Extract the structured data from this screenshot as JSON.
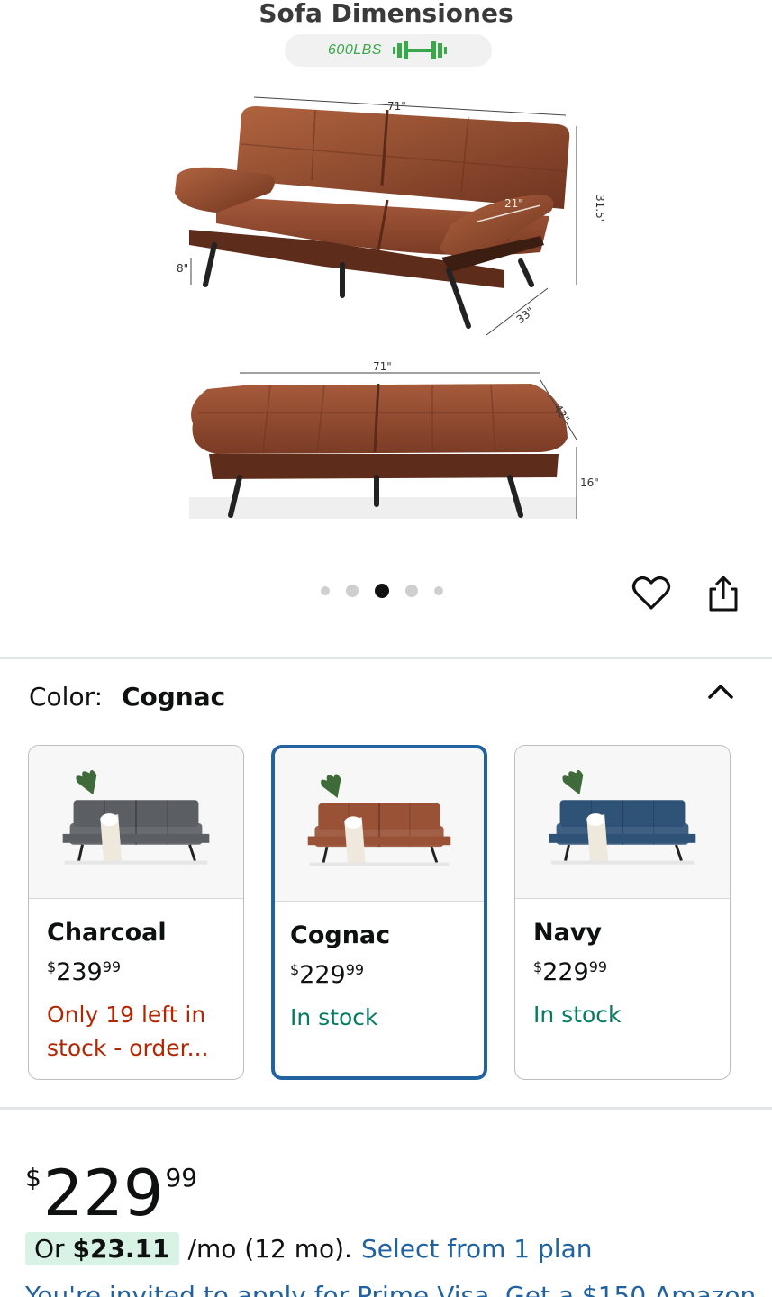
{
  "hero": {
    "title": "Sofa Dimensiones",
    "weight_label": "600LBS",
    "dimensions": {
      "top_width": "71\"",
      "arm_length": "21\"",
      "height": "31.5\"",
      "leg_height": "8\"",
      "depth": "33\"",
      "bed_width": "71\"",
      "bed_depth": "42\"",
      "bed_height": "16\""
    },
    "carousel": {
      "count": 5,
      "active_index": 2
    }
  },
  "actions": {
    "favorite_icon": "heart-icon",
    "share_icon": "share-icon"
  },
  "color_selector": {
    "label": "Color:",
    "selected": "Cognac",
    "options": [
      {
        "name": "Charcoal",
        "dollars": "239",
        "cents": "99",
        "stock": "Only 19 left in stock - order...",
        "stock_type": "low",
        "color": "#5b5e63"
      },
      {
        "name": "Cognac",
        "dollars": "229",
        "cents": "99",
        "stock": "In stock",
        "stock_type": "in",
        "color": "#9a5236"
      },
      {
        "name": "Navy",
        "dollars": "229",
        "cents": "99",
        "stock": "In stock",
        "stock_type": "in",
        "color": "#2f5377"
      }
    ]
  },
  "price": {
    "currency": "$",
    "dollars": "229",
    "cents": "99"
  },
  "financing": {
    "prefix": "Or",
    "amount": "$23.11",
    "terms": "/mo (12 mo).",
    "link": "Select from 1 plan"
  },
  "promo": {
    "text": "You're invited to apply for Prime Visa. Get a $150 Amazon"
  },
  "colors": {
    "link": "#2162a1",
    "selected_border": "#2162a1",
    "low_stock": "#b12704",
    "in_stock": "#067d62",
    "sofa_leather": "#8f4a30"
  }
}
